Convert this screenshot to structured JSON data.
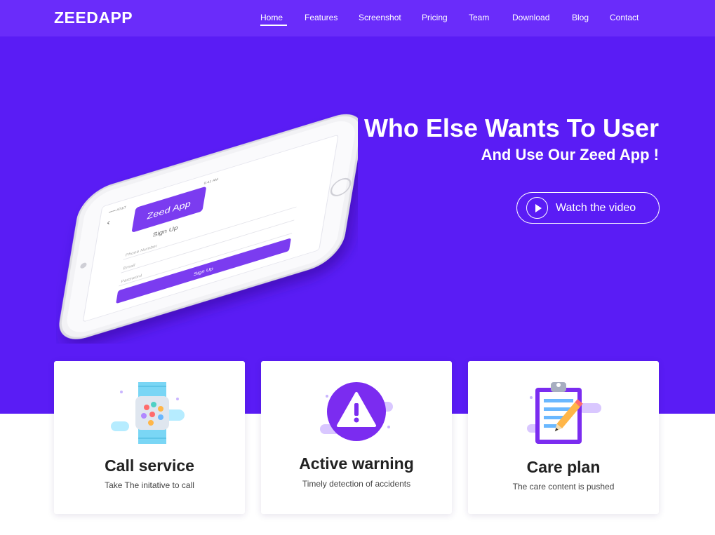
{
  "brand": {
    "logo": "ZEEDAPP"
  },
  "nav": {
    "items": [
      "Home",
      "Features",
      "Screenshot",
      "Pricing",
      "Team",
      "Download",
      "Blog",
      "Contact"
    ],
    "active": "Home"
  },
  "hero": {
    "title": "Who Else Wants To User",
    "subtitle": "And Use Our Zeed App !",
    "video_button": "Watch the video"
  },
  "phone_screen": {
    "app_badge": "Zeed App",
    "heading": "Sign Up",
    "fields": [
      "Phone Number",
      "Email",
      "Password"
    ],
    "submit": "Sign Up",
    "status_time": "9:41 AM",
    "status_carrier": "••••• AT&T"
  },
  "features": [
    {
      "icon": "smartwatch-icon",
      "title": "Call service",
      "desc": "Take The initative to call"
    },
    {
      "icon": "warning-icon",
      "title": "Active warning",
      "desc": "Timely detection of accidents"
    },
    {
      "icon": "clipboard-pencil-icon",
      "title": "Care plan",
      "desc": "The care content is pushed"
    }
  ],
  "colors": {
    "primary": "#5a1cf5",
    "navbar": "#6a2cfa",
    "accent": "#7b3cf0",
    "card_bg": "#ffffff"
  }
}
